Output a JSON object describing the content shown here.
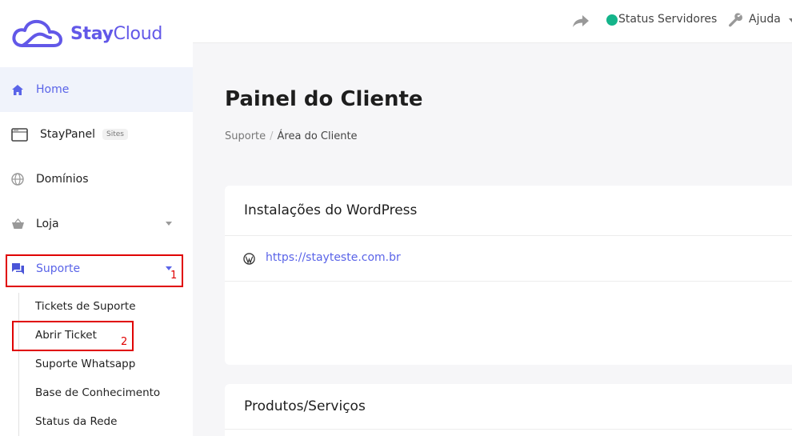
{
  "brand": {
    "stay": "Stay",
    "cloud": "Cloud"
  },
  "sidebar": {
    "items": [
      {
        "label": "Home",
        "icon": "home-icon"
      },
      {
        "label": "StayPanel",
        "badge": "Sites",
        "icon": "window-icon"
      },
      {
        "label": "Domínios",
        "icon": "globe-icon"
      },
      {
        "label": "Loja",
        "icon": "basket-icon"
      },
      {
        "label": "Suporte",
        "icon": "chat-icon"
      }
    ],
    "subitems": [
      {
        "label": "Tickets de Suporte"
      },
      {
        "label": "Abrir Ticket"
      },
      {
        "label": "Suporte Whatsapp"
      },
      {
        "label": "Base de Conhecimento"
      },
      {
        "label": "Status da Rede"
      }
    ]
  },
  "annotations": {
    "first": "1",
    "second": "2"
  },
  "topbar": {
    "status_label": "Status Servidores",
    "help_label": "Ajuda",
    "status_color": "#14b48a"
  },
  "main": {
    "title": "Painel do Cliente",
    "breadcrumb": {
      "parent": "Suporte",
      "separator": "/",
      "current": "Área do Cliente"
    },
    "wordpress_card": {
      "title": "Instalações do WordPress",
      "link": "https://stayteste.com.br"
    },
    "products_card": {
      "title": "Produtos/Serviços"
    }
  },
  "colors": {
    "accent": "#5a64e8",
    "annotation": "#e00000",
    "active_bg": "#f0f3fb"
  }
}
